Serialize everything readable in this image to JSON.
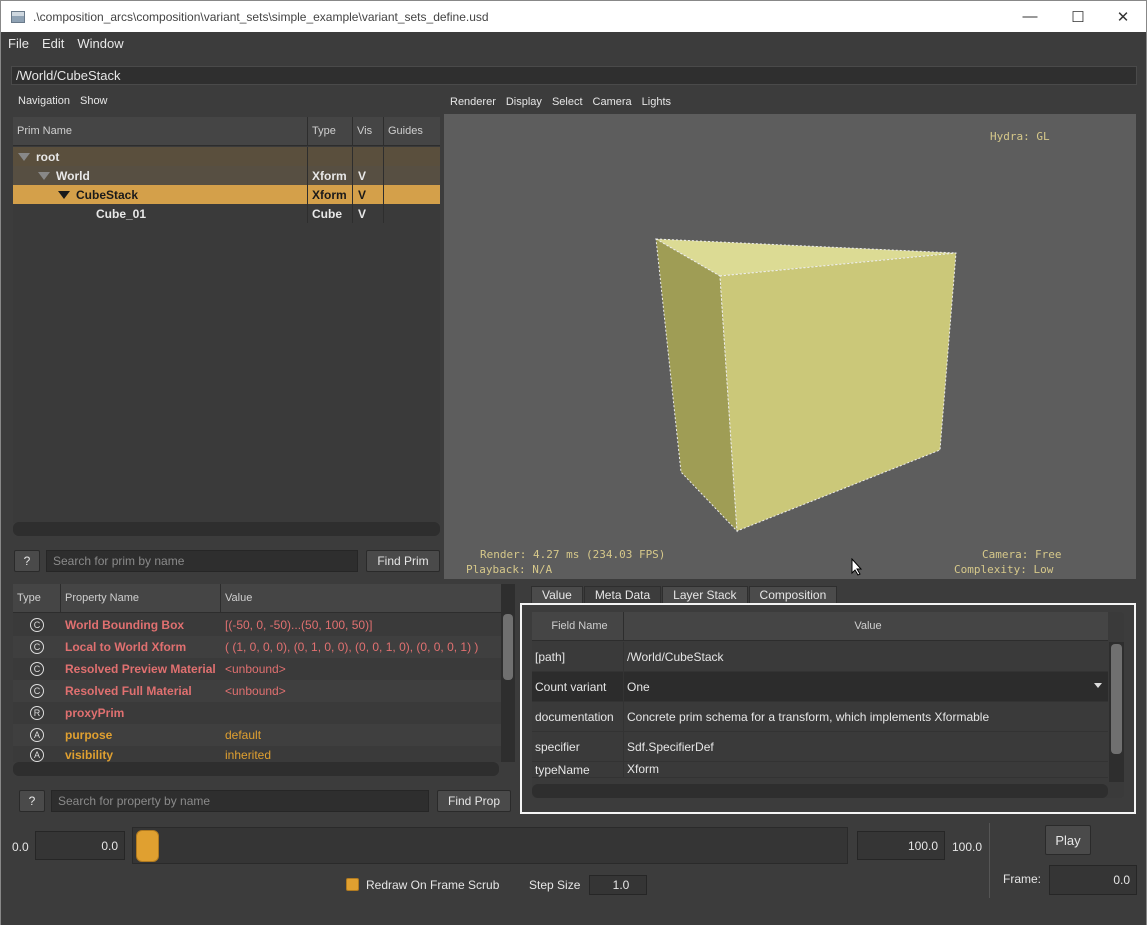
{
  "window": {
    "title": ".\\composition_arcs\\composition\\variant_sets\\simple_example\\variant_sets_define.usd",
    "minimize": "—",
    "maximize": "☐",
    "close": "✕"
  },
  "menu": [
    "File",
    "Edit",
    "Window"
  ],
  "path": "/World/CubeStack",
  "tree": {
    "toolbar": [
      "Navigation",
      "Show"
    ],
    "columns": [
      "Prim Name",
      "Type",
      "Vis",
      "Guides"
    ],
    "rows": [
      {
        "name": "root",
        "type": "",
        "vis": ""
      },
      {
        "name": "World",
        "type": "Xform",
        "vis": "V"
      },
      {
        "name": "CubeStack",
        "type": "Xform",
        "vis": "V"
      },
      {
        "name": "Cube_01",
        "type": "Cube",
        "vis": "V"
      }
    ],
    "help": "?",
    "search_placeholder": "Search for prim by name",
    "find": "Find Prim"
  },
  "viewport": {
    "toolbar": [
      "Renderer",
      "Display",
      "Select",
      "Camera",
      "Lights"
    ],
    "hydra": "Hydra: GL",
    "render": "Render: 4.27 ms (234.03 FPS)",
    "playback": "Playback: N/A",
    "camera": "Camera: Free",
    "complexity": "Complexity: Low"
  },
  "props": {
    "columns": [
      "Type",
      "Property Name",
      "Value"
    ],
    "rows": [
      {
        "icon": "C",
        "name": "World Bounding Box",
        "value": "[(-50, 0, -50)...(50, 100, 50)]",
        "color": "#e07070"
      },
      {
        "icon": "C",
        "name": "Local to World Xform",
        "value": "( (1, 0, 0, 0), (0, 1, 0, 0), (0, 0, 1, 0), (0, 0, 0, 1) )",
        "color": "#e07070"
      },
      {
        "icon": "C",
        "name": "Resolved Preview Material",
        "value": "<unbound>",
        "color": "#e07070"
      },
      {
        "icon": "C",
        "name": "Resolved Full Material",
        "value": "<unbound>",
        "color": "#e07070"
      },
      {
        "icon": "R",
        "name": "proxyPrim",
        "value": "",
        "color": "#e07070"
      },
      {
        "icon": "A",
        "name": "purpose",
        "value": "default",
        "color": "#e0a030"
      },
      {
        "icon": "A",
        "name": "visibility",
        "value": "inherited",
        "color": "#e0a030"
      }
    ],
    "help": "?",
    "search_placeholder": "Search for property by name",
    "find": "Find Prop"
  },
  "meta": {
    "tabs": [
      "Value",
      "Meta Data",
      "Layer Stack",
      "Composition"
    ],
    "columns": [
      "Field Name",
      "Value"
    ],
    "rows": [
      {
        "field": "[path]",
        "value": "/World/CubeStack"
      },
      {
        "field": "Count variant",
        "value": "One"
      },
      {
        "field": "documentation",
        "value": "Concrete prim schema for a transform, which implements Xformable"
      },
      {
        "field": "specifier",
        "value": "Sdf.SpecifierDef"
      },
      {
        "field": "typeName",
        "value": "Xform"
      }
    ]
  },
  "timeline": {
    "start_label": "0.0",
    "start_value": "0.0",
    "end_value": "100.0",
    "end_label": "100.0",
    "play": "Play",
    "redraw": "Redraw On Frame Scrub",
    "step_label": "Step Size",
    "step_value": "1.0",
    "frame_label": "Frame:",
    "frame_value": "0.0"
  },
  "colors": {
    "accent": "#d9a030",
    "selected_row": "#d4a04a",
    "cube": "#d8d68a"
  }
}
